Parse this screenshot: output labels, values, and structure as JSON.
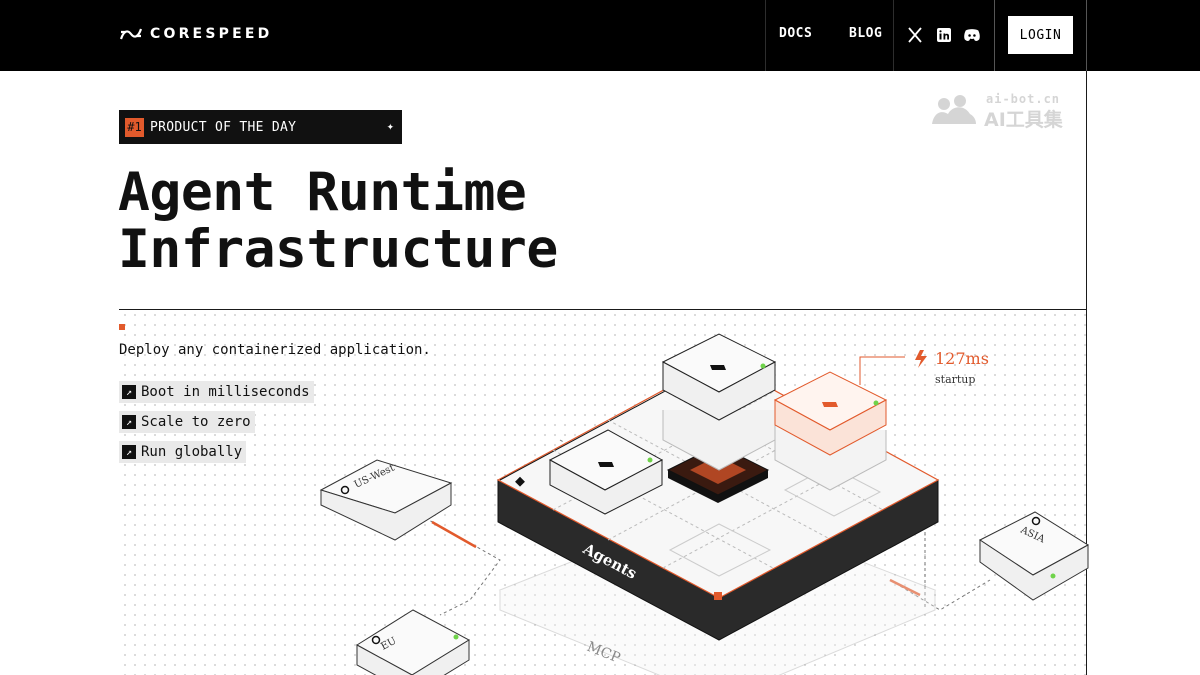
{
  "header": {
    "brand": "CORESPEED",
    "nav": [
      {
        "label": "DOCS"
      },
      {
        "label": "BLOG"
      }
    ],
    "social_icons": [
      "x-icon",
      "linkedin-icon",
      "discord-icon"
    ],
    "login_label": "LOGIN"
  },
  "badge": {
    "rank": "#1",
    "text": "PRODUCT OF THE DAY",
    "star": "✦"
  },
  "hero": {
    "title_line1": "Agent Runtime",
    "title_line2": "Infrastructure"
  },
  "watermark": {
    "line1": "ai-bot.cn",
    "line2": "AI工具集"
  },
  "intro": {
    "subtitle": "Deploy any containerized application.",
    "features": [
      {
        "icon": "arrow-up-right-icon",
        "label": "Boot in milliseconds"
      },
      {
        "icon": "arrow-up-right-icon",
        "label": "Scale to zero"
      },
      {
        "icon": "arrow-up-right-icon",
        "label": "Run globally"
      }
    ]
  },
  "diagram": {
    "platform_label": "Agents",
    "lower_label": "MCP",
    "startup_value": "127ms",
    "startup_caption": "startup",
    "regions": [
      "US-West",
      "EU",
      "ASIA"
    ]
  },
  "colors": {
    "accent": "#e25a2c",
    "background": "#ffffff",
    "topbar": "#000000"
  }
}
